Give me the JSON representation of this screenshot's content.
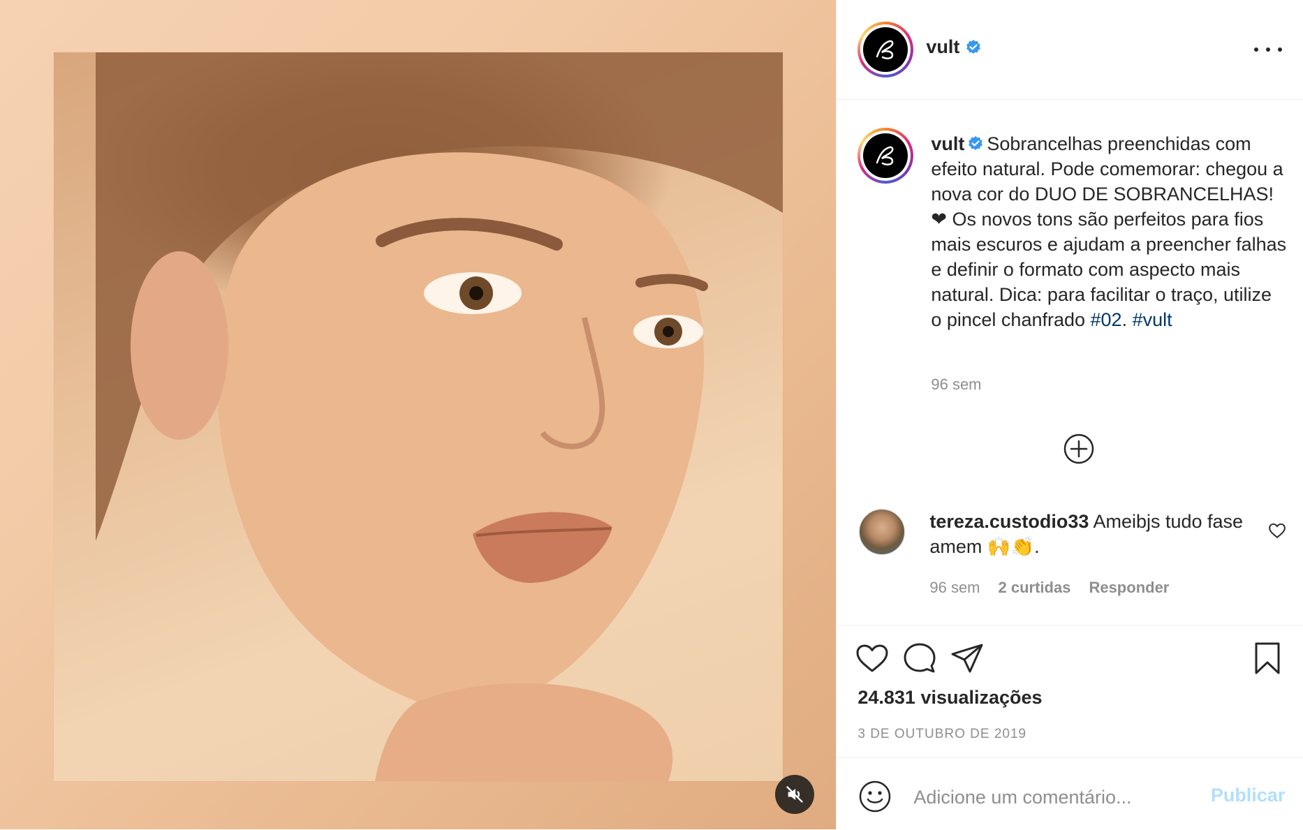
{
  "colors": {
    "verified": "#3897f0",
    "hashtag": "#00376b",
    "muted_text": "#8e8e8e",
    "publish_disabled": "#b2dffc"
  },
  "header": {
    "username": "vult",
    "verified_icon": "verified-badge-icon",
    "more_icon": "more-options-icon"
  },
  "caption": {
    "username": "vult",
    "text": "Sobrancelhas preenchidas com efeito natural. Pode comemorar: chegou a nova cor do DUO DE SOBRANCELHAS! ❤ Os novos tons são perfeitos para fios mais escuros e ajudam a preencher falhas e definir o formato com aspecto mais natural. Dica: para facilitar o traço, utilize o pincel chanfrado ",
    "hashtag_1": "#02",
    "separator": ". ",
    "hashtag_2": "#vult",
    "time": "96 sem"
  },
  "load_more_icon": "plus-circle-icon",
  "comment": {
    "username": "tereza.custodio33",
    "text": " Ameibjs tudo fase amem 🙌👏.",
    "time": "96 sem",
    "likes": "2 curtidas",
    "reply": "Responder"
  },
  "actions": {
    "like_icon": "heart-icon",
    "comment_icon": "comment-icon",
    "share_icon": "share-icon",
    "save_icon": "bookmark-icon",
    "views": "24.831 visualizações",
    "date": "3 DE OUTUBRO DE 2019"
  },
  "add_comment": {
    "placeholder": "Adicione um comentário...",
    "publish": "Publicar",
    "emoji_icon": "emoji-icon"
  },
  "media": {
    "mute_icon": "muted-speaker-icon"
  }
}
